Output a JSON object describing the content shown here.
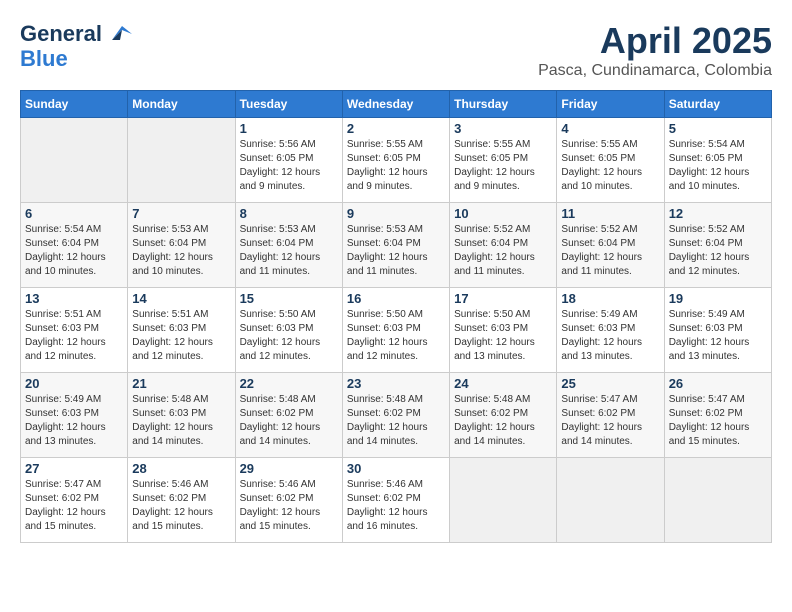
{
  "header": {
    "logo_general": "General",
    "logo_blue": "Blue",
    "title": "April 2025",
    "location": "Pasca, Cundinamarca, Colombia"
  },
  "days_of_week": [
    "Sunday",
    "Monday",
    "Tuesday",
    "Wednesday",
    "Thursday",
    "Friday",
    "Saturday"
  ],
  "weeks": [
    [
      {
        "day": "",
        "detail": ""
      },
      {
        "day": "",
        "detail": ""
      },
      {
        "day": "1",
        "detail": "Sunrise: 5:56 AM\nSunset: 6:05 PM\nDaylight: 12 hours\nand 9 minutes."
      },
      {
        "day": "2",
        "detail": "Sunrise: 5:55 AM\nSunset: 6:05 PM\nDaylight: 12 hours\nand 9 minutes."
      },
      {
        "day": "3",
        "detail": "Sunrise: 5:55 AM\nSunset: 6:05 PM\nDaylight: 12 hours\nand 9 minutes."
      },
      {
        "day": "4",
        "detail": "Sunrise: 5:55 AM\nSunset: 6:05 PM\nDaylight: 12 hours\nand 10 minutes."
      },
      {
        "day": "5",
        "detail": "Sunrise: 5:54 AM\nSunset: 6:05 PM\nDaylight: 12 hours\nand 10 minutes."
      }
    ],
    [
      {
        "day": "6",
        "detail": "Sunrise: 5:54 AM\nSunset: 6:04 PM\nDaylight: 12 hours\nand 10 minutes."
      },
      {
        "day": "7",
        "detail": "Sunrise: 5:53 AM\nSunset: 6:04 PM\nDaylight: 12 hours\nand 10 minutes."
      },
      {
        "day": "8",
        "detail": "Sunrise: 5:53 AM\nSunset: 6:04 PM\nDaylight: 12 hours\nand 11 minutes."
      },
      {
        "day": "9",
        "detail": "Sunrise: 5:53 AM\nSunset: 6:04 PM\nDaylight: 12 hours\nand 11 minutes."
      },
      {
        "day": "10",
        "detail": "Sunrise: 5:52 AM\nSunset: 6:04 PM\nDaylight: 12 hours\nand 11 minutes."
      },
      {
        "day": "11",
        "detail": "Sunrise: 5:52 AM\nSunset: 6:04 PM\nDaylight: 12 hours\nand 11 minutes."
      },
      {
        "day": "12",
        "detail": "Sunrise: 5:52 AM\nSunset: 6:04 PM\nDaylight: 12 hours\nand 12 minutes."
      }
    ],
    [
      {
        "day": "13",
        "detail": "Sunrise: 5:51 AM\nSunset: 6:03 PM\nDaylight: 12 hours\nand 12 minutes."
      },
      {
        "day": "14",
        "detail": "Sunrise: 5:51 AM\nSunset: 6:03 PM\nDaylight: 12 hours\nand 12 minutes."
      },
      {
        "day": "15",
        "detail": "Sunrise: 5:50 AM\nSunset: 6:03 PM\nDaylight: 12 hours\nand 12 minutes."
      },
      {
        "day": "16",
        "detail": "Sunrise: 5:50 AM\nSunset: 6:03 PM\nDaylight: 12 hours\nand 12 minutes."
      },
      {
        "day": "17",
        "detail": "Sunrise: 5:50 AM\nSunset: 6:03 PM\nDaylight: 12 hours\nand 13 minutes."
      },
      {
        "day": "18",
        "detail": "Sunrise: 5:49 AM\nSunset: 6:03 PM\nDaylight: 12 hours\nand 13 minutes."
      },
      {
        "day": "19",
        "detail": "Sunrise: 5:49 AM\nSunset: 6:03 PM\nDaylight: 12 hours\nand 13 minutes."
      }
    ],
    [
      {
        "day": "20",
        "detail": "Sunrise: 5:49 AM\nSunset: 6:03 PM\nDaylight: 12 hours\nand 13 minutes."
      },
      {
        "day": "21",
        "detail": "Sunrise: 5:48 AM\nSunset: 6:03 PM\nDaylight: 12 hours\nand 14 minutes."
      },
      {
        "day": "22",
        "detail": "Sunrise: 5:48 AM\nSunset: 6:02 PM\nDaylight: 12 hours\nand 14 minutes."
      },
      {
        "day": "23",
        "detail": "Sunrise: 5:48 AM\nSunset: 6:02 PM\nDaylight: 12 hours\nand 14 minutes."
      },
      {
        "day": "24",
        "detail": "Sunrise: 5:48 AM\nSunset: 6:02 PM\nDaylight: 12 hours\nand 14 minutes."
      },
      {
        "day": "25",
        "detail": "Sunrise: 5:47 AM\nSunset: 6:02 PM\nDaylight: 12 hours\nand 14 minutes."
      },
      {
        "day": "26",
        "detail": "Sunrise: 5:47 AM\nSunset: 6:02 PM\nDaylight: 12 hours\nand 15 minutes."
      }
    ],
    [
      {
        "day": "27",
        "detail": "Sunrise: 5:47 AM\nSunset: 6:02 PM\nDaylight: 12 hours\nand 15 minutes."
      },
      {
        "day": "28",
        "detail": "Sunrise: 5:46 AM\nSunset: 6:02 PM\nDaylight: 12 hours\nand 15 minutes."
      },
      {
        "day": "29",
        "detail": "Sunrise: 5:46 AM\nSunset: 6:02 PM\nDaylight: 12 hours\nand 15 minutes."
      },
      {
        "day": "30",
        "detail": "Sunrise: 5:46 AM\nSunset: 6:02 PM\nDaylight: 12 hours\nand 16 minutes."
      },
      {
        "day": "",
        "detail": ""
      },
      {
        "day": "",
        "detail": ""
      },
      {
        "day": "",
        "detail": ""
      }
    ]
  ]
}
